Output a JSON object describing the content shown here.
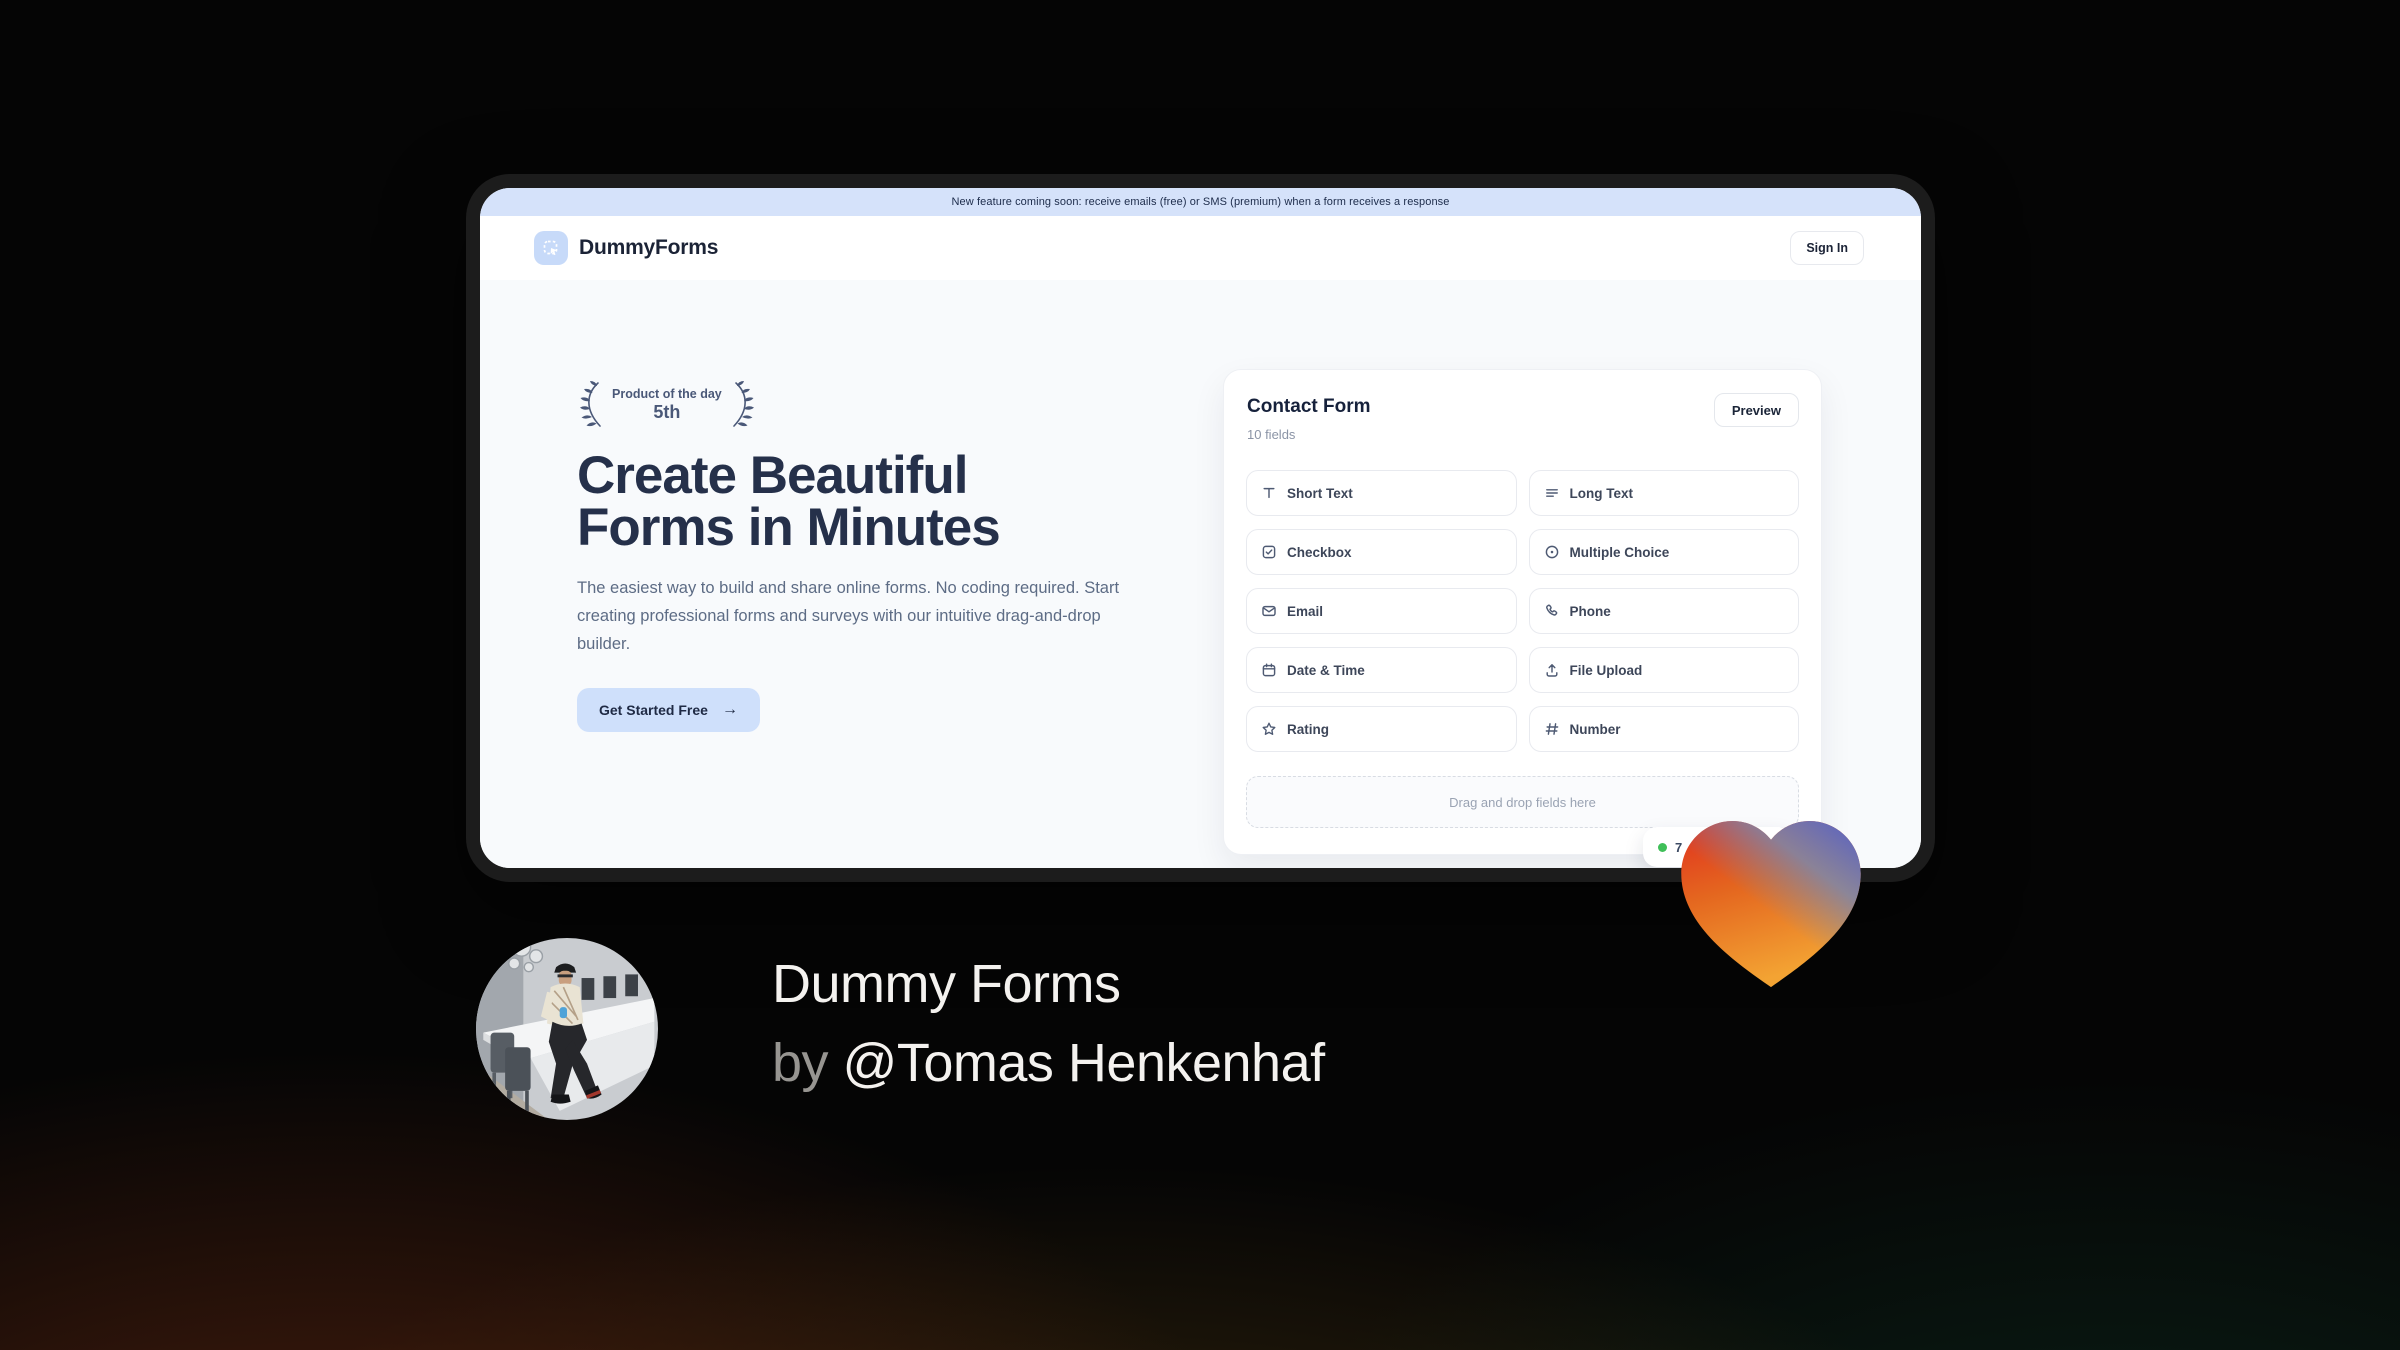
{
  "banner": {
    "text": "New feature coming soon: receive emails (free) or SMS (premium) when a form receives a response",
    "bg_color": "#d5e2fa"
  },
  "header": {
    "brand": "DummyForms",
    "logo_icon": "cursor-selection-icon",
    "logo_tile_color": "#c7daf9",
    "sign_in_label": "Sign In"
  },
  "hero": {
    "award": {
      "line1": "Product of the day",
      "line2": "5th",
      "laurel_icon": "laurel-branch-icon",
      "color": "#4a5878"
    },
    "title": "Create Beautiful Forms in Minutes",
    "description": "The easiest way to build and share online forms. No coding required. Start creating professional forms and surveys with our intuitive drag-and-drop builder.",
    "cta_label": "Get Started Free",
    "cta_icon": "arrow-right-icon",
    "cta_bg_color": "#cfe0fb"
  },
  "builder": {
    "title": "Contact Form",
    "field_count": "10 fields",
    "preview_label": "Preview",
    "fields": [
      {
        "label": "Short Text",
        "icon": "short-text-icon"
      },
      {
        "label": "Long Text",
        "icon": "long-text-icon"
      },
      {
        "label": "Checkbox",
        "icon": "checkbox-icon"
      },
      {
        "label": "Multiple Choice",
        "icon": "radio-circle-icon"
      },
      {
        "label": "Email",
        "icon": "envelope-icon"
      },
      {
        "label": "Phone",
        "icon": "phone-icon"
      },
      {
        "label": "Date & Time",
        "icon": "calendar-icon"
      },
      {
        "label": "File Upload",
        "icon": "upload-icon"
      },
      {
        "label": "Rating",
        "icon": "star-icon"
      },
      {
        "label": "Number",
        "icon": "hash-icon"
      }
    ],
    "dropzone_text": "Drag and drop fields here",
    "status_badge": {
      "visible_text": "7",
      "dot_color": "#3fbf58"
    }
  },
  "heart_logo": {
    "icon": "gradient-heart-icon",
    "colors": {
      "red": "#e63a20",
      "orange": "#f19c2e",
      "blue": "#5b63c0",
      "slate": "#7b87ac"
    }
  },
  "credit": {
    "product_name": "Dummy Forms",
    "byline_prefix": "by ",
    "author_handle": "@Tomas Henkenhaf"
  }
}
